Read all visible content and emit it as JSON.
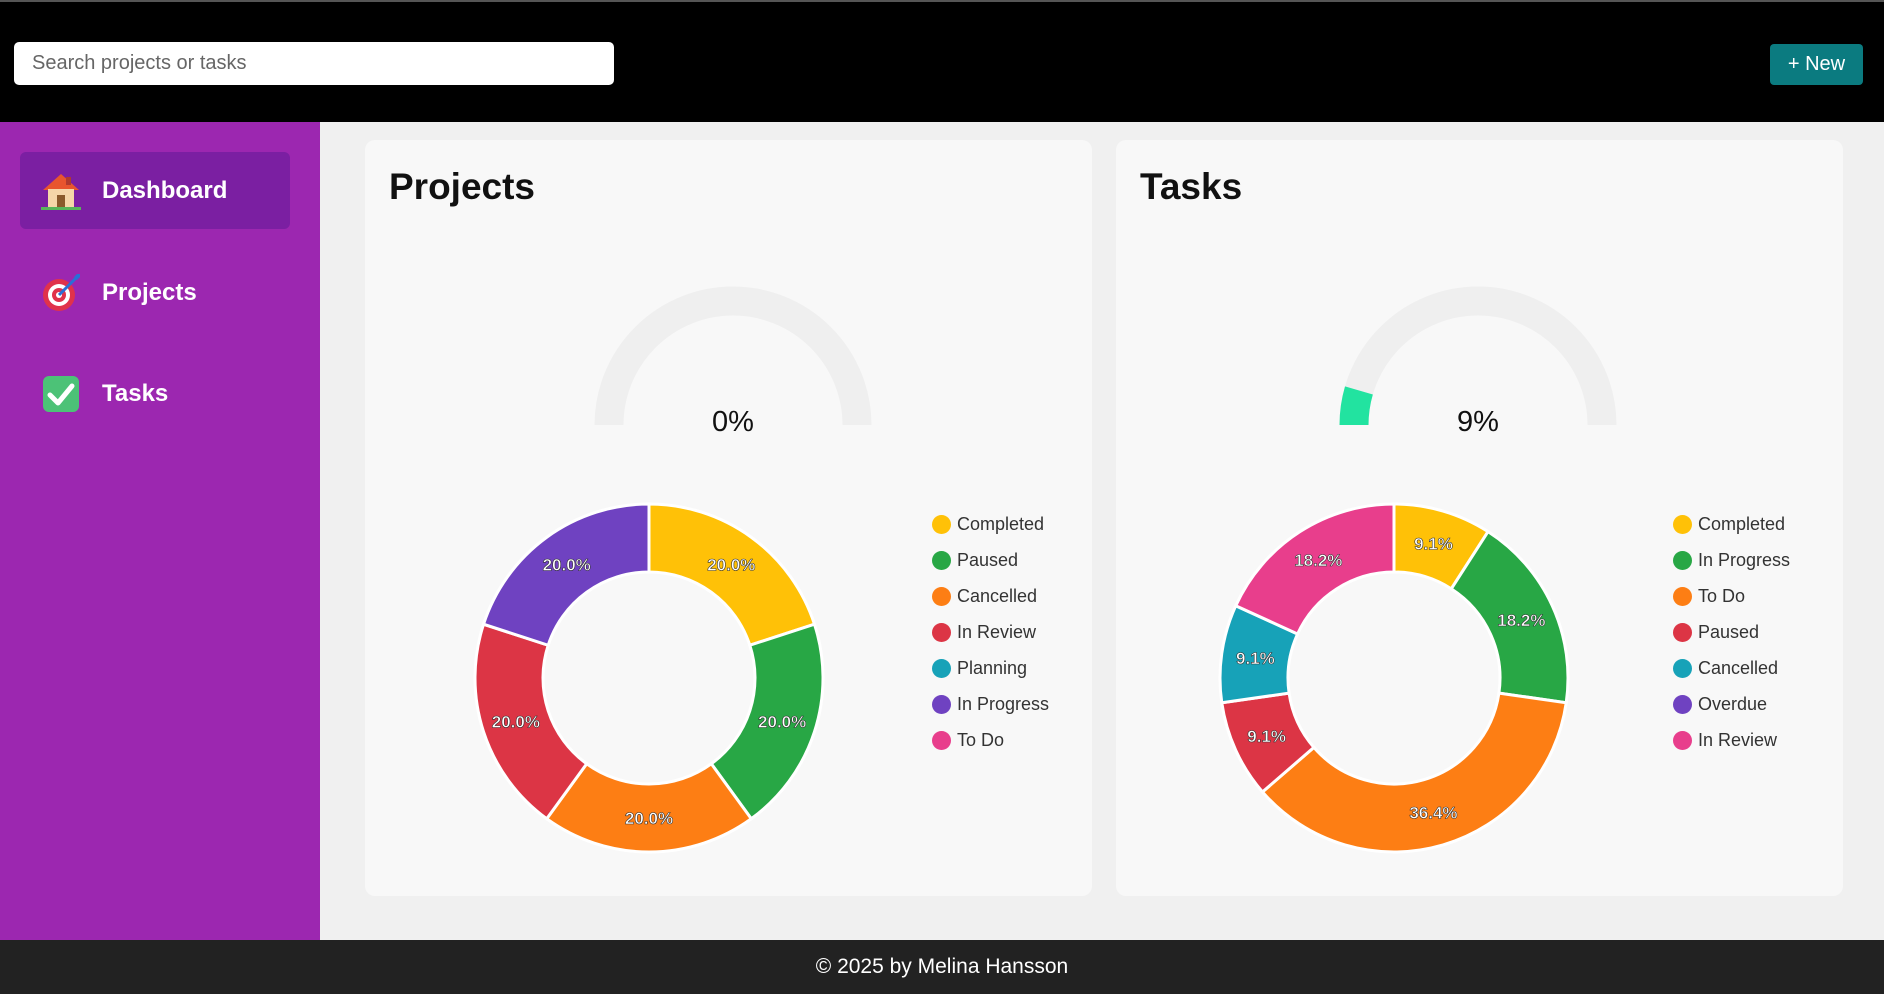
{
  "header": {
    "search_placeholder": "Search projects or tasks",
    "new_button_label": "+ New"
  },
  "sidebar": {
    "items": [
      {
        "label": "Dashboard",
        "icon": "house-emoji-icon",
        "active": true
      },
      {
        "label": "Projects",
        "icon": "target-emoji-icon",
        "active": false
      },
      {
        "label": "Tasks",
        "icon": "checkmark-emoji-icon",
        "active": false
      }
    ]
  },
  "colors": {
    "sidebar": "#9c27b0",
    "sidebar_active": "#7b1fa2",
    "new_button": "#0b7b80",
    "gauge_fill": "#22e3a0",
    "gauge_track": "#efefef"
  },
  "footer": {
    "text": "© 2025 by Melina Hansson"
  },
  "chart_data": [
    {
      "type": "gauge",
      "title": "Projects",
      "value": 0,
      "value_label": "0%",
      "range": [
        0,
        100
      ]
    },
    {
      "type": "pie",
      "variant": "donut",
      "card_title": "Projects",
      "categories": [
        "Completed",
        "Paused",
        "Cancelled",
        "In Review",
        "Planning",
        "In Progress",
        "To Do"
      ],
      "values": [
        20,
        20,
        20,
        20,
        0,
        20,
        0
      ],
      "value_labels": [
        "20.0%",
        "20.0%",
        "20.0%",
        "20.0%",
        "",
        "20.0%",
        ""
      ],
      "colors": [
        "#ffc107",
        "#28a745",
        "#fd7e14",
        "#dc3545",
        "#17a2b8",
        "#6f42c1",
        "#e83e8c"
      ],
      "legend_position": "right"
    },
    {
      "type": "gauge",
      "title": "Tasks",
      "value": 9,
      "value_label": "9%",
      "range": [
        0,
        100
      ]
    },
    {
      "type": "pie",
      "variant": "donut",
      "card_title": "Tasks",
      "categories": [
        "Completed",
        "In Progress",
        "To Do",
        "Paused",
        "Cancelled",
        "Overdue",
        "In Review"
      ],
      "values": [
        9.1,
        18.2,
        36.4,
        9.1,
        9.1,
        0,
        18.2
      ],
      "value_labels": [
        "9.1%",
        "18.2%",
        "36.4%",
        "9.1%",
        "9.1%",
        "",
        "18.2%"
      ],
      "colors": [
        "#ffc107",
        "#28a745",
        "#fd7e14",
        "#dc3545",
        "#17a2b8",
        "#6f42c1",
        "#e83e8c"
      ],
      "legend_position": "right"
    }
  ]
}
